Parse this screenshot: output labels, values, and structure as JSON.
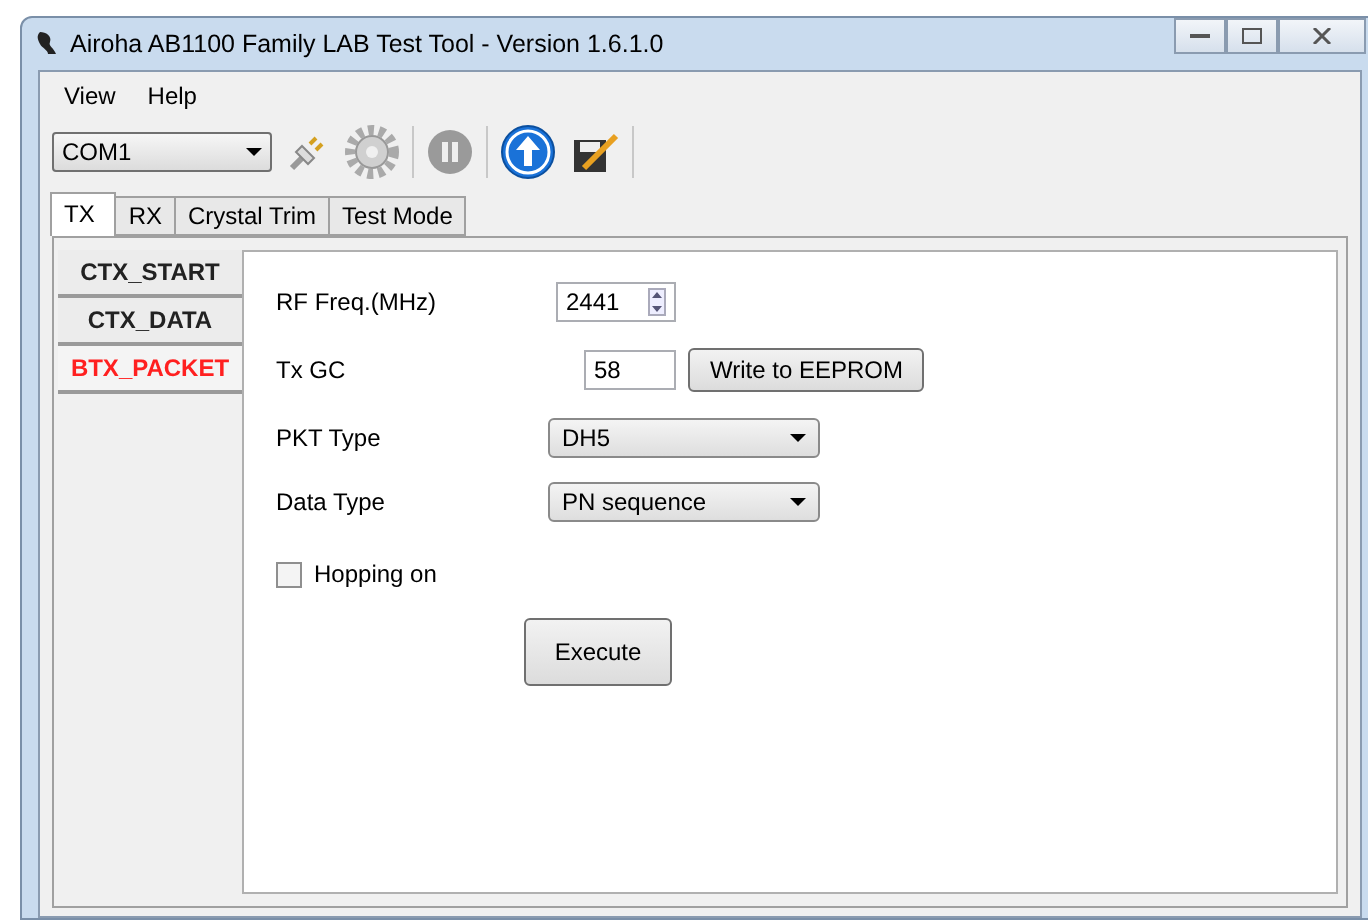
{
  "window": {
    "title": "Airoha AB1100 Family LAB Test Tool - Version 1.6.1.0"
  },
  "menu": [
    "View",
    "Help"
  ],
  "toolbar": {
    "port": "COM1"
  },
  "tabs": [
    {
      "label": "TX",
      "selected": true
    },
    {
      "label": "RX",
      "selected": false
    },
    {
      "label": "Crystal Trim",
      "selected": false
    },
    {
      "label": "Test Mode",
      "selected": false
    }
  ],
  "side_tabs": [
    {
      "label": "CTX_START",
      "selected": false
    },
    {
      "label": "CTX_DATA",
      "selected": false
    },
    {
      "label": "BTX_PACKET",
      "selected": true
    }
  ],
  "form": {
    "rf_freq": {
      "label": "RF Freq.(MHz)",
      "value": "2441"
    },
    "tx_gc": {
      "label": "Tx GC",
      "value": "58",
      "button": "Write to EEPROM"
    },
    "pkt_type": {
      "label": "PKT Type",
      "value": "DH5"
    },
    "data_type": {
      "label": "Data Type",
      "value": "PN sequence"
    },
    "hopping": {
      "label": "Hopping on",
      "checked": false
    },
    "execute": "Execute"
  }
}
